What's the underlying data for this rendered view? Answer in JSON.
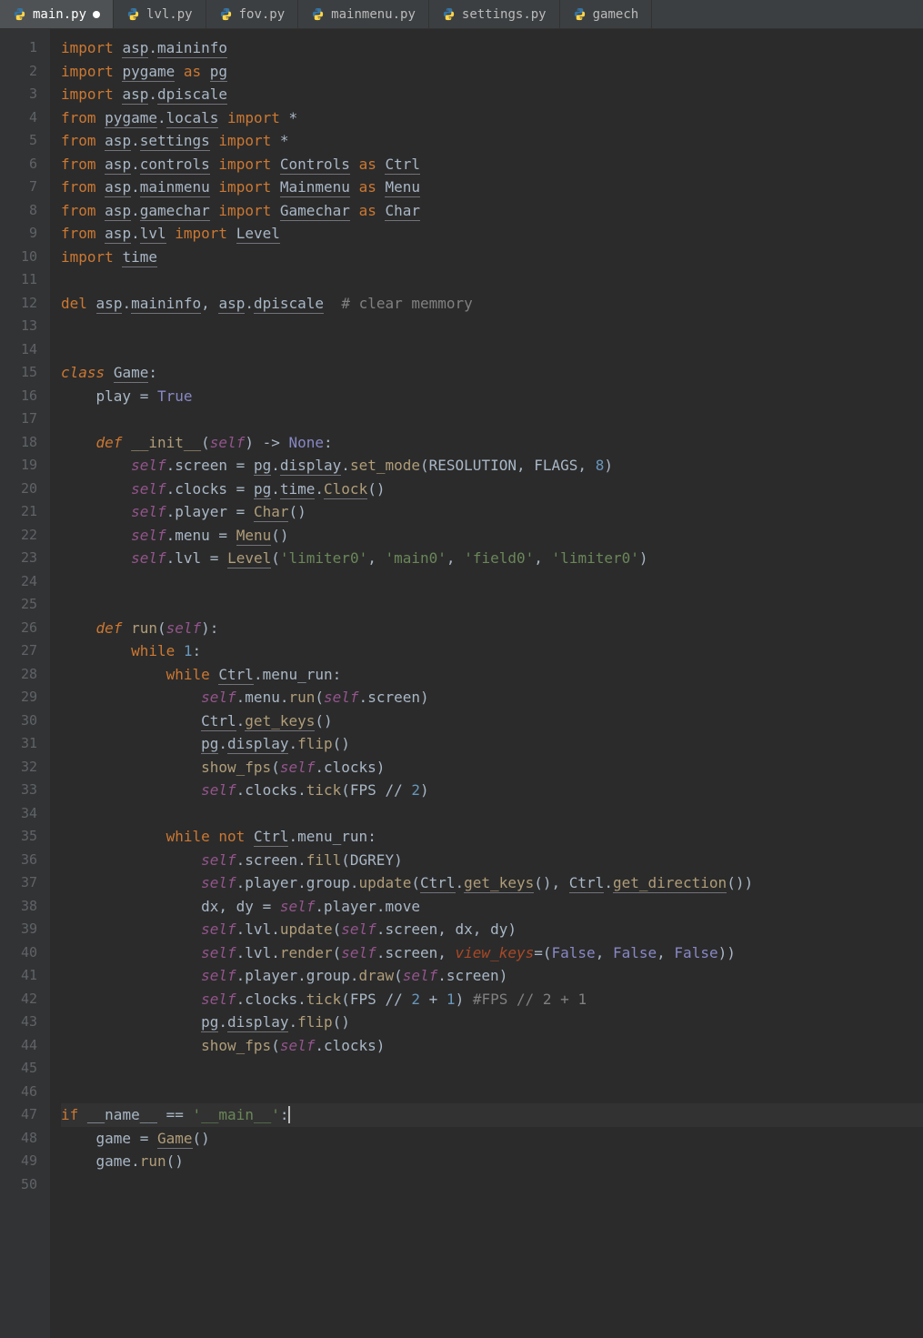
{
  "tabs": [
    {
      "label": "main.py",
      "active": true,
      "modified": true
    },
    {
      "label": "lvl.py",
      "active": false,
      "modified": false
    },
    {
      "label": "fov.py",
      "active": false,
      "modified": false
    },
    {
      "label": "mainmenu.py",
      "active": false,
      "modified": false
    },
    {
      "label": "settings.py",
      "active": false,
      "modified": false
    },
    {
      "label": "gamech",
      "active": false,
      "modified": false
    }
  ],
  "gutter": [
    "1",
    "2",
    "3",
    "4",
    "5",
    "6",
    "7",
    "8",
    "9",
    "10",
    "11",
    "12",
    "13",
    "14",
    "15",
    "16",
    "17",
    "18",
    "19",
    "20",
    "21",
    "22",
    "23",
    "24",
    "25",
    "26",
    "27",
    "28",
    "29",
    "30",
    "31",
    "32",
    "33",
    "34",
    "35",
    "36",
    "37",
    "38",
    "39",
    "40",
    "41",
    "42",
    "43",
    "44",
    "45",
    "46",
    "47",
    "48",
    "49",
    "50"
  ],
  "t": {
    "import": "import",
    "from": "from",
    "as": "as",
    "del": "del",
    "class": "class",
    "def": "def",
    "while": "while",
    "not": "not",
    "if": "if",
    "asp": "asp",
    "maininfo": "maininfo",
    "pygame": "pygame",
    "pg": "pg",
    "dpiscale": "dpiscale",
    "locals": "locals",
    "settings": "settings",
    "controls": "controls",
    "Controls": "Controls",
    "Ctrl": "Ctrl",
    "mainmenu": "mainmenu",
    "Mainmenu": "Mainmenu",
    "Menu": "Menu",
    "gamechar": "gamechar",
    "Gamechar": "Gamechar",
    "Char": "Char",
    "lvl": "lvl",
    "Level": "Level",
    "time": "time",
    "clear_mem": "# clear memmory",
    "Game": "Game",
    "play": "play",
    "True": "True",
    "None": "None",
    "False": "False",
    "init": "__init__",
    "self": "self",
    "screen": "screen",
    "display": "display",
    "set_mode": "set_mode",
    "RESOLUTION": "RESOLUTION",
    "FLAGS": "FLAGS",
    "eight": "8",
    "clocks": "clocks",
    "Clock": "Clock",
    "player": "player",
    "menu": "menu",
    "limiter0": "'limiter0'",
    "main0": "'main0'",
    "field0": "'field0'",
    "run": "run",
    "one": "1",
    "menu_run": "menu_run",
    "get_keys": "get_keys",
    "flip": "flip",
    "show_fps": "show_fps",
    "tick": "tick",
    "FPS": "FPS",
    "two": "2",
    "fill": "fill",
    "DGREY": "DGREY",
    "group": "group",
    "update": "update",
    "get_direction": "get_direction",
    "dx": "dx",
    "dy": "dy",
    "move": "move",
    "render": "render",
    "view_keys": "view_keys",
    "draw": "draw",
    "fps_comment": "#FPS // 2 + 1",
    "name": "__name__",
    "main_str": "'__main__'",
    "game": "game",
    "star": "*",
    "arrow": "->",
    "eq": "=",
    "eqeq": "==",
    "colon": ":",
    "dot": ".",
    "comma": ",",
    "lpar": "(",
    "rpar": ")",
    "dslash": "//",
    "plus": "+"
  }
}
